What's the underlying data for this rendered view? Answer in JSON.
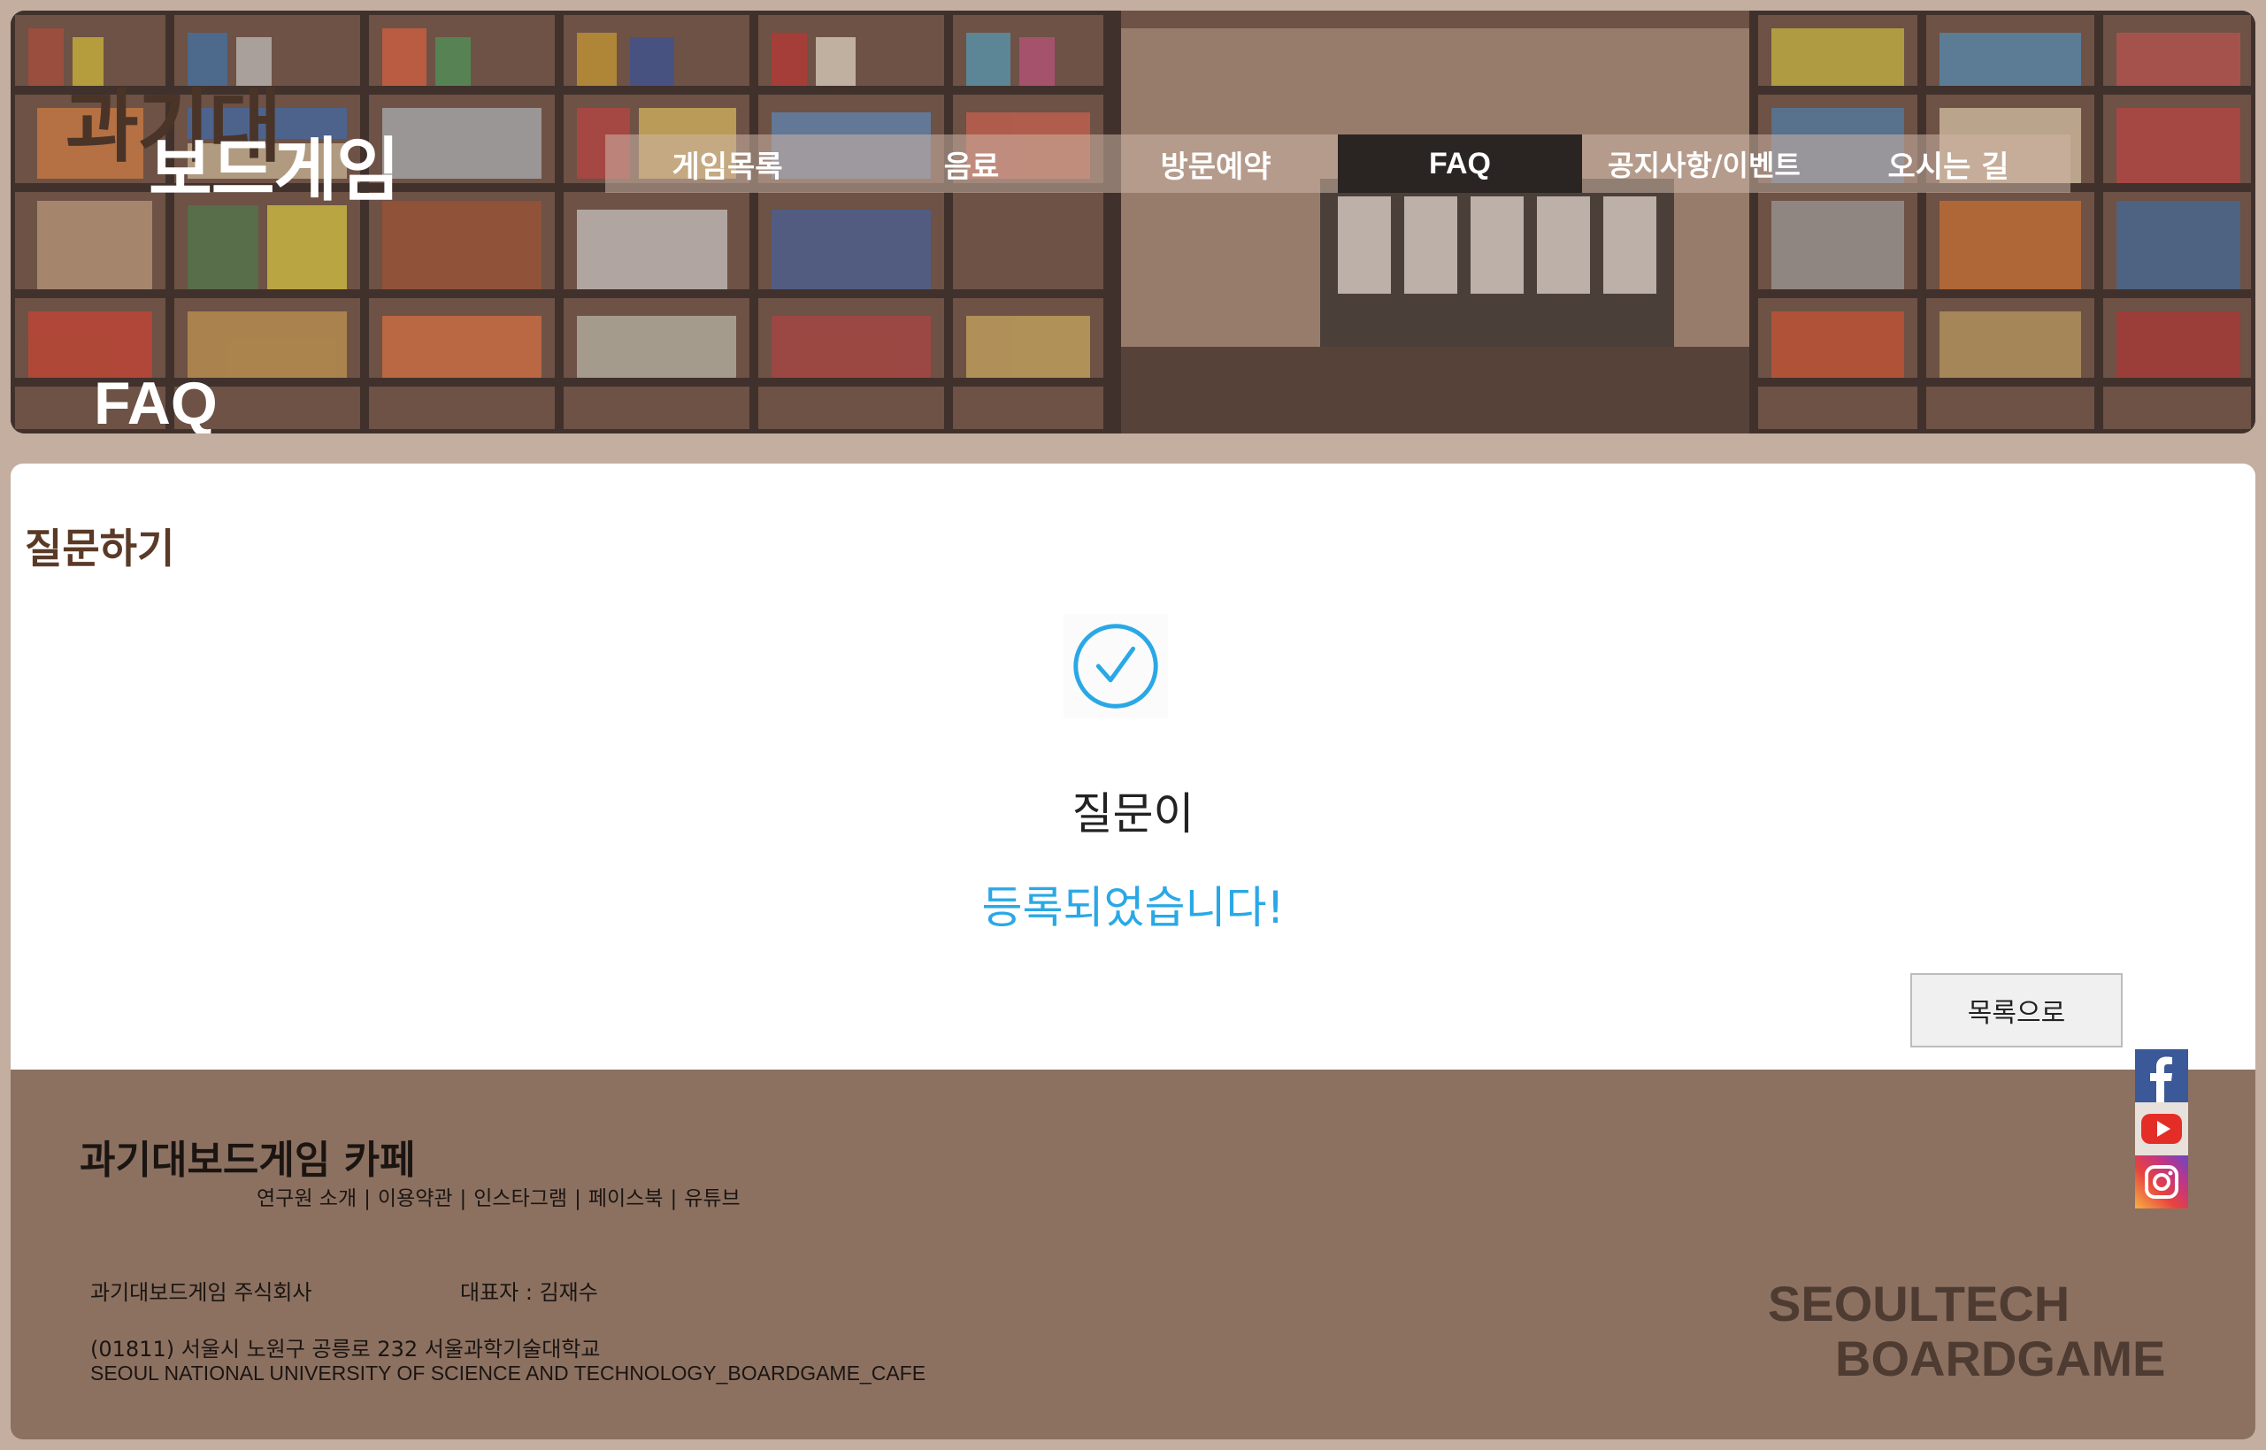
{
  "header": {
    "logo_top": "과기대",
    "logo_bottom": "보드게임",
    "nav": [
      {
        "label": "게임목록",
        "active": false
      },
      {
        "label": "음료",
        "active": false
      },
      {
        "label": "방문예약",
        "active": false
      },
      {
        "label": "FAQ",
        "active": true
      },
      {
        "label": "공지사항/이벤트",
        "active": false
      },
      {
        "label": "오시는 길",
        "active": false
      }
    ],
    "page_title": "FAQ"
  },
  "main": {
    "section_title": "질문하기",
    "message_line1": "질문이",
    "message_line2": "등록되었습니다!",
    "back_button": "목록으로"
  },
  "footer": {
    "brand": "과기대보드게임 카페",
    "links": [
      "연구원 소개",
      "이용약관",
      "인스타그램",
      "페이스북",
      "유튜브"
    ],
    "company": "과기대보드게임 주식회사",
    "ceo": "대표자 : 김재수",
    "address": "(01811) 서울시 노원구 공릉로 232 서울과학기술대학교",
    "address_en": "SEOUL NATIONAL UNIVERSITY OF SCIENCE AND TECHNOLOGY_BOARDGAME_CAFE",
    "logo_line1": "SEOULTECH",
    "logo_line2": "BOARDGAME"
  },
  "social": [
    "facebook-icon",
    "youtube-icon",
    "instagram-icon"
  ],
  "colors": {
    "page_bg": "#c4aea0",
    "footer_bg": "#8c7161",
    "accent_blue": "#2aa8e6",
    "active_nav": "#2a2422",
    "heading_brown": "#5a3a26"
  }
}
